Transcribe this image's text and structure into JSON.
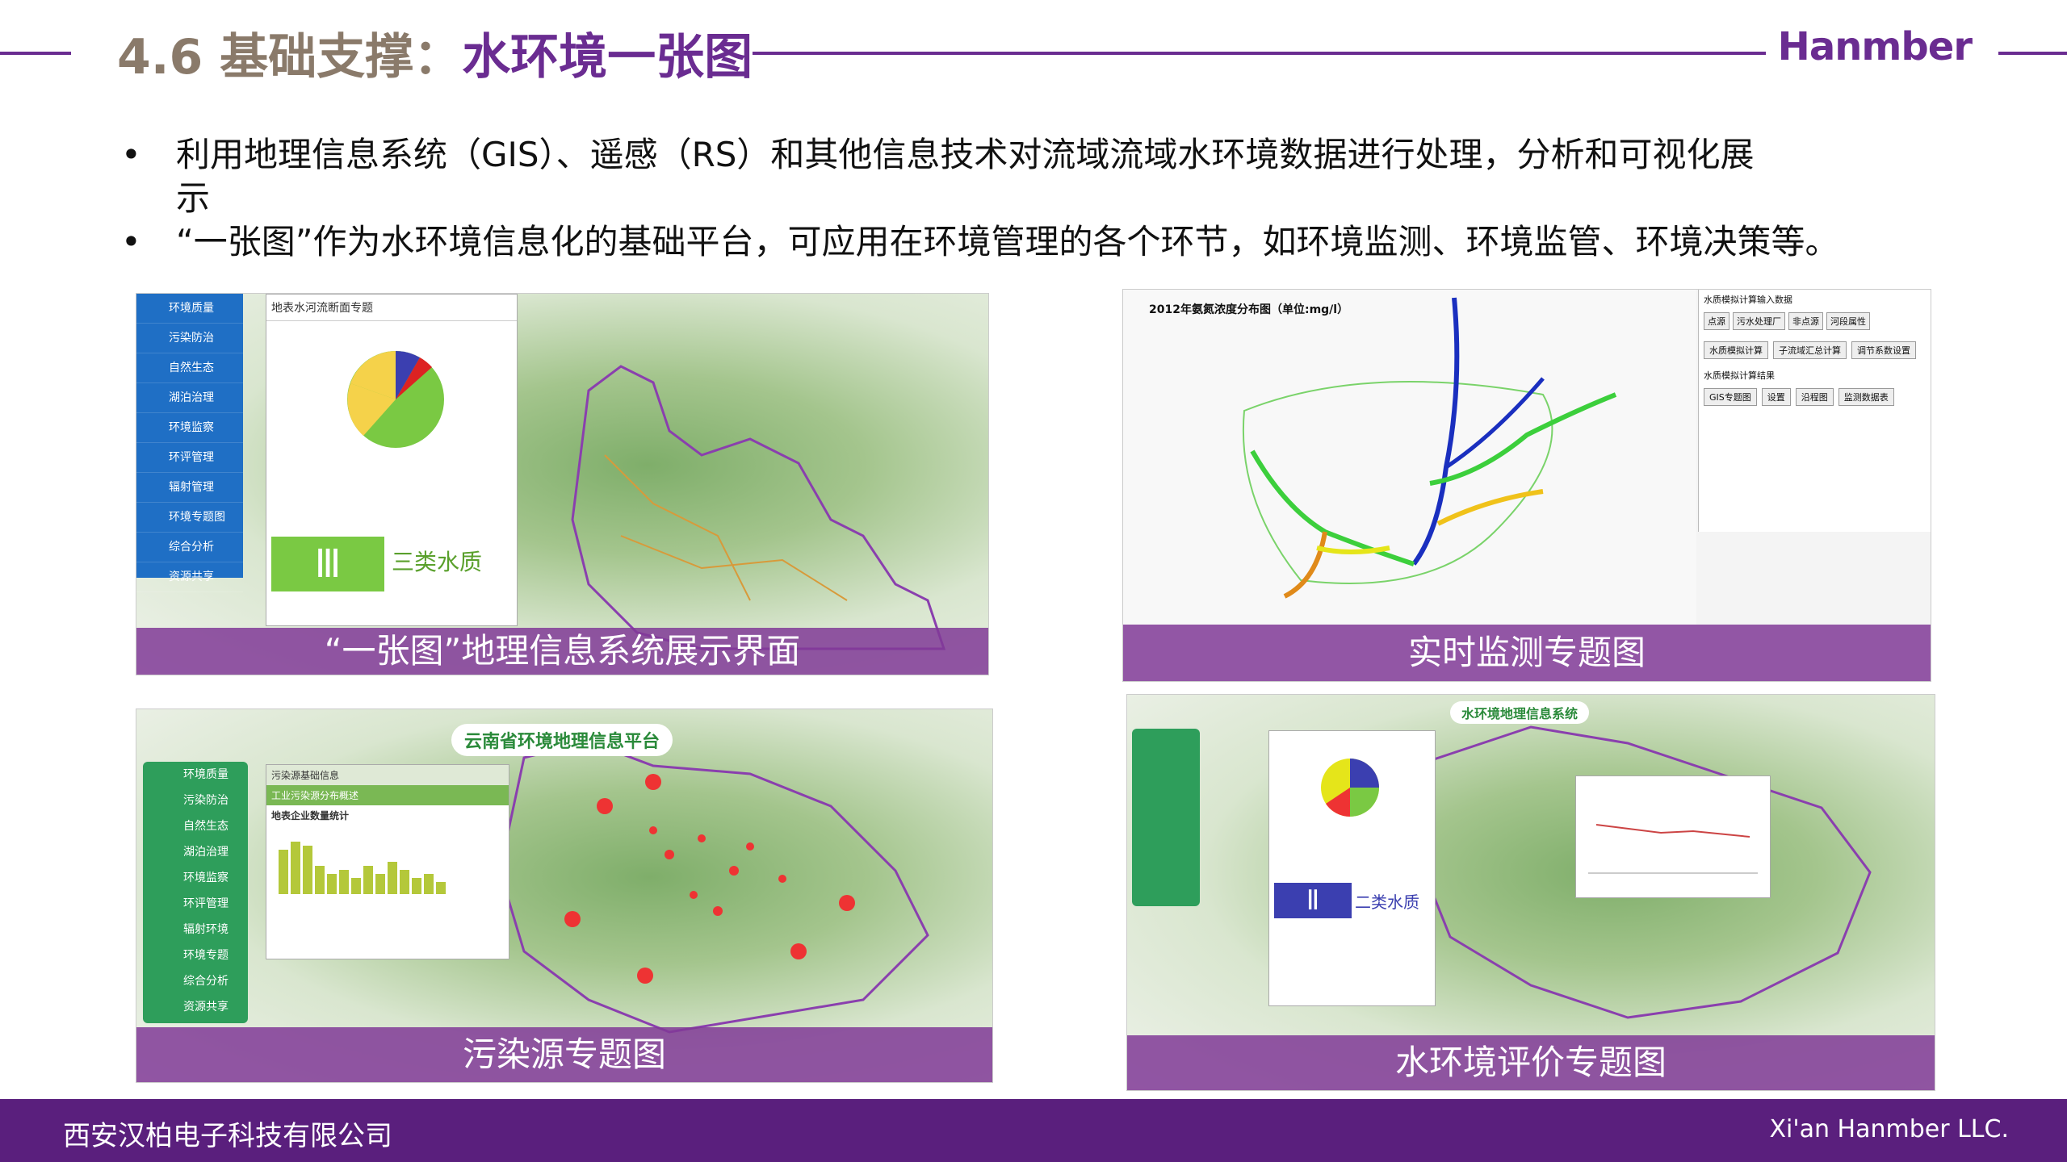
{
  "header": {
    "section_number": "4.6 基础支撑：",
    "title": "水环境一张图",
    "brand": "Hanmber"
  },
  "bullets": [
    "利用地理信息系统（GIS）、遥感（RS）和其他信息技术对流域流域水环境数据进行处理，分析和可视化展示",
    "“一张图”作为水环境信息化的基础平台，可应用在环境管理的各个环节，如环境监测、环境监管、环境决策等。"
  ],
  "panels": {
    "p1": {
      "caption": "“一张图”地理信息系统展示界面",
      "menu": [
        "环境质量",
        "污染防治",
        "自然生态",
        "湖泊治理",
        "环境监察",
        "环评管理",
        "辐射管理",
        "环境专题图",
        "综合分析",
        "资源共享"
      ],
      "popup_title": "地表水河流断面专题",
      "grade_roman": "Ⅲ",
      "grade_text": "三类水质"
    },
    "p2": {
      "caption": "实时监测专题图",
      "map_title": "2012年氨氮浓度分布图（单位:mg/l）",
      "side_title": "水质模拟计算输入数据",
      "side_btns": [
        "点源",
        "污水处理厂",
        "非点源",
        "河段属性"
      ],
      "side_btn2": "水质模拟计算",
      "side_btn3": "子流域汇总计算",
      "side_btn4": "调节系数设置",
      "result_title": "水质模拟计算结果",
      "result_btns": [
        "GIS专题图",
        "设置",
        "沿程图",
        "监测数据表"
      ]
    },
    "p3": {
      "caption": "污染源专题图",
      "platform": "云南省环境地理信息平台",
      "menu": [
        "环境质量",
        "污染防治",
        "自然生态",
        "湖泊治理",
        "环境监察",
        "环评管理",
        "辐射环境",
        "环境专题",
        "综合分析",
        "资源共享"
      ],
      "popup_title": "污染源基础信息",
      "popup_sub": "工业污染源分布概述",
      "chart_title": "地表企业数量统计"
    },
    "p4": {
      "caption": "水环境评价专题图",
      "platform": "水环境地理信息系统",
      "grade_roman": "Ⅱ",
      "grade_text": "二类水质"
    }
  },
  "footer": {
    "company_cn": "西安汉柏电子科技有限公司",
    "company_en": "Xi'an Hanmber LLC."
  },
  "colors": {
    "accent": "#6a2c91",
    "footer": "#5a1f7d",
    "caption_bg": "#803a96"
  }
}
